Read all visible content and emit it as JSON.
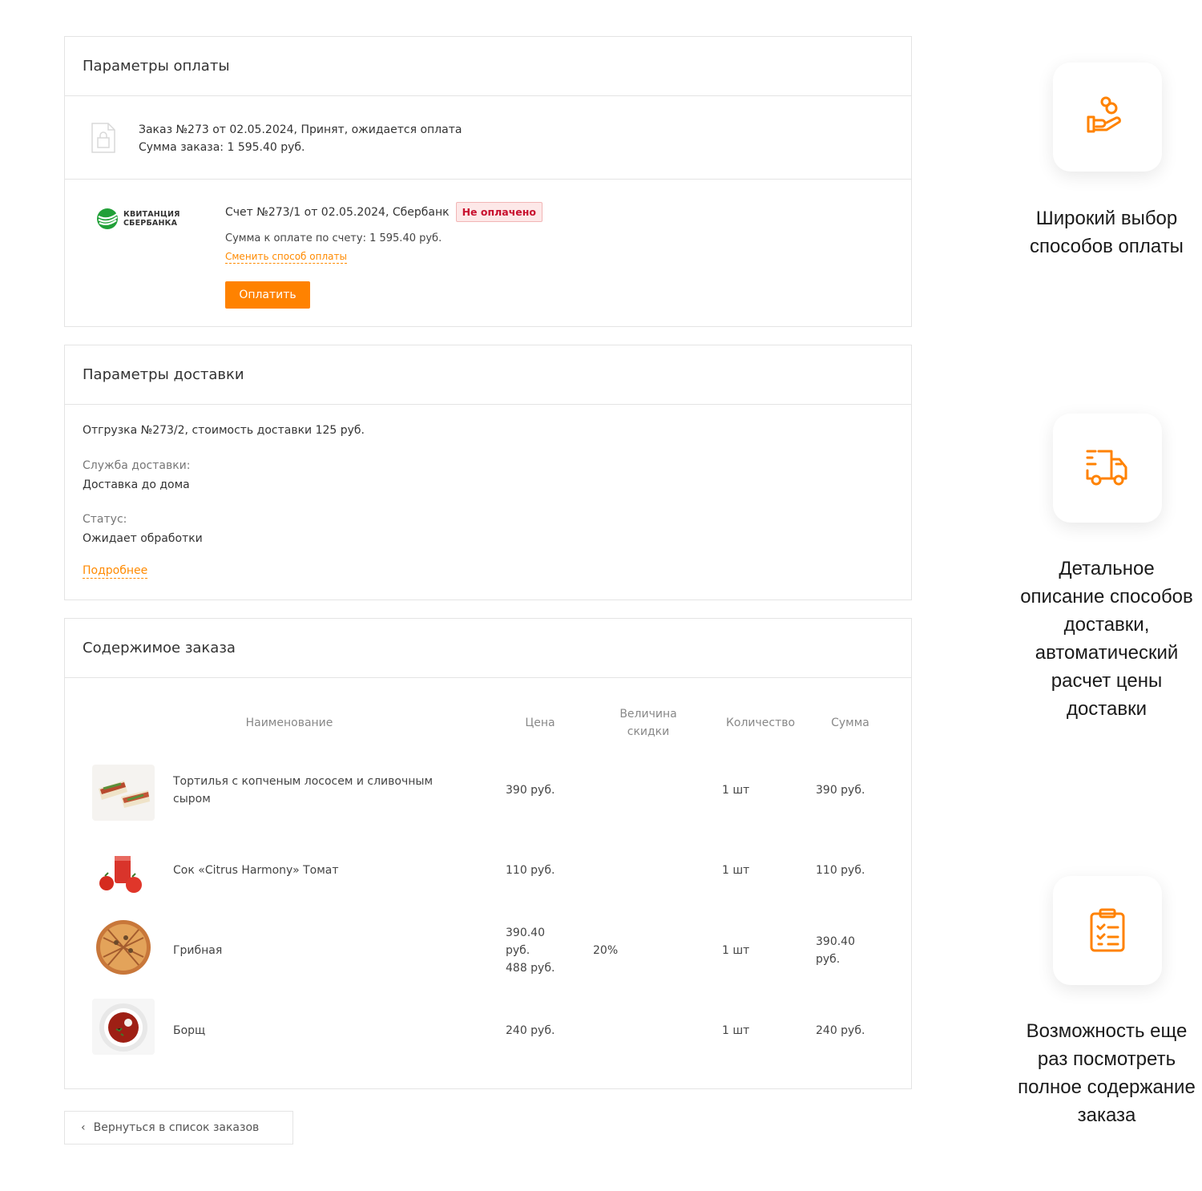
{
  "payment": {
    "title": "Параметры оплаты",
    "order_line1": "Заказ №273 от 02.05.2024, Принят, ожидается оплата",
    "order_line2": "Сумма заказа: 1 595.40 руб.",
    "logo_line1": "КВИТАНЦИЯ",
    "logo_line2": "СБЕРБАНКА",
    "bill_title": "Счет №273/1 от 02.05.2024, Сбербанк",
    "status_badge": "Не оплачено",
    "bill_sum": "Сумма к оплате по счету: 1 595.40 руб.",
    "change_link": "Сменить способ оплаты",
    "pay_button": "Оплатить"
  },
  "delivery": {
    "title": "Параметры доставки",
    "shipment": "Отгрузка №273/2, стоимость доставки 125 руб.",
    "service_label": "Служба доставки:",
    "service_value": "Доставка до дома",
    "status_label": "Статус:",
    "status_value": "Ожидает обработки",
    "more_link": "Подробнее"
  },
  "content": {
    "title": "Содержимое заказа",
    "headers": {
      "name": "Наименование",
      "price": "Цена",
      "discount_line1": "Величина",
      "discount_line2": "скидки",
      "qty": "Количество",
      "sum": "Сумма"
    },
    "items": [
      {
        "name_line1": "Тортилья с копченым лососем и сливочным",
        "name_line2": "сыром",
        "price_line1": "390 руб.",
        "price_line2": "",
        "price_line3": "",
        "discount": "",
        "qty": "1 шт",
        "sum_line1": "390 руб.",
        "sum_line2": ""
      },
      {
        "name_line1": "Сок «Citrus Harmony» Томат",
        "name_line2": "",
        "price_line1": "110 руб.",
        "price_line2": "",
        "price_line3": "",
        "discount": "",
        "qty": "1 шт",
        "sum_line1": "110 руб.",
        "sum_line2": ""
      },
      {
        "name_line1": "Грибная",
        "name_line2": "",
        "price_line1": "390.40",
        "price_line2": "руб.",
        "price_line3": "488 руб.",
        "discount": "20%",
        "qty": "1 шт",
        "sum_line1": "390.40",
        "sum_line2": "руб."
      },
      {
        "name_line1": "Борщ",
        "name_line2": "",
        "price_line1": "240 руб.",
        "price_line2": "",
        "price_line3": "",
        "discount": "",
        "qty": "1 шт",
        "sum_line1": "240 руб.",
        "sum_line2": ""
      }
    ]
  },
  "back_button": "Вернуться в список заказов",
  "features": [
    {
      "icon": "hand-coins-icon",
      "line1": "Широкий выбор",
      "line2": "способов оплаты"
    },
    {
      "icon": "delivery-truck-icon",
      "line1": "Детальное",
      "line2": "описание способов",
      "line3": "доставки,",
      "line4": "автоматический",
      "line5": "расчет цены",
      "line6": "доставки"
    },
    {
      "icon": "clipboard-list-icon",
      "line1": "Возможность еще",
      "line2": "раз посмотреть",
      "line3": "полное содержание",
      "line4": "заказа"
    }
  ],
  "colors": {
    "accent": "#ff8200",
    "badge_text": "#c8102e",
    "sber_green": "#21a038"
  }
}
